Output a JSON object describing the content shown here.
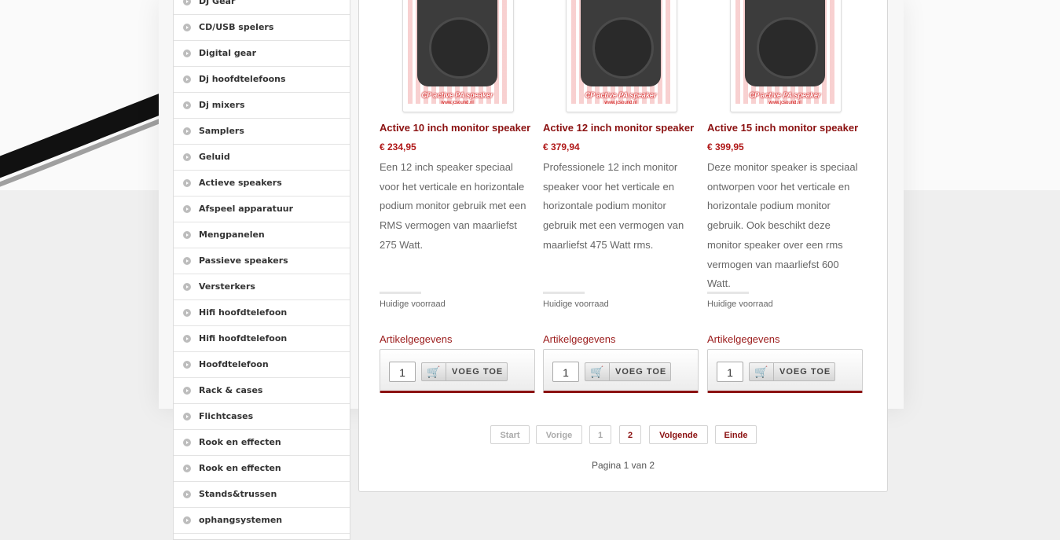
{
  "sidebar": {
    "items": [
      {
        "label": "DJ Gear"
      },
      {
        "label": "CD/USB spelers"
      },
      {
        "label": "Digital gear"
      },
      {
        "label": "Dj hoofdtelefoons"
      },
      {
        "label": "Dj mixers"
      },
      {
        "label": "Samplers"
      },
      {
        "label": "Geluid"
      },
      {
        "label": "Actieve speakers"
      },
      {
        "label": "Afspeel apparatuur"
      },
      {
        "label": "Mengpanelen"
      },
      {
        "label": "Passieve speakers"
      },
      {
        "label": "Versterkers"
      },
      {
        "label": "Hifi hoofdtelefoon"
      },
      {
        "label": "Hifi hoofdtelefoon"
      },
      {
        "label": "Hoofdtelefoon"
      },
      {
        "label": "Rack & cases"
      },
      {
        "label": "Flichtcases"
      },
      {
        "label": "Rook en effecten"
      },
      {
        "label": "Rook en effecten"
      },
      {
        "label": "Stands&trussen"
      },
      {
        "label": "ophangsystemen"
      }
    ]
  },
  "products": [
    {
      "image_label": "CP active PA speaker",
      "image_url_text": "www.jcsound.nl",
      "title": "Active 10 inch monitor speaker",
      "price": "€ 234,95",
      "description": "Een 12 inch speaker speciaal voor het verticale en horizontale podium monitor gebruik met een RMS vermogen van maarliefst 275 Watt.",
      "stock_label": "Huidige voorraad",
      "details_label": "Artikelgegevens",
      "quantity": "1",
      "add_label": "VOEG TOE"
    },
    {
      "image_label": "CP active PA speaker",
      "image_url_text": "www.jcsound.nl",
      "title": "Active 12 inch monitor speaker",
      "price": "€ 379,94",
      "description": "Professionele 12 inch monitor speaker voor het verticale en horizontale podium monitor gebruik met een vermogen van maarliefst 475 Watt rms.",
      "stock_label": "Huidige voorraad",
      "details_label": "Artikelgegevens",
      "quantity": "1",
      "add_label": "VOEG TOE"
    },
    {
      "image_label": "CP active PA speaker",
      "image_url_text": "www.jcsound.nl",
      "title": "Active 15 inch monitor speaker",
      "price": "€ 399,95",
      "description": "Deze monitor speaker is speciaal ontworpen voor het verticale en horizontale podium monitor gebruik. Ook beschikt deze monitor speaker over een rms vermogen van maarliefst 600 Watt.",
      "stock_label": "Huidige voorraad",
      "details_label": "Artikelgegevens",
      "quantity": "1",
      "add_label": "VOEG TOE"
    }
  ],
  "pagination": {
    "start": "Start",
    "prev": "Vorige",
    "page1": "1",
    "page2": "2",
    "next": "Volgende",
    "end": "Einde",
    "info": "Pagina 1 van 2"
  },
  "icons": {
    "cart": "cart-icon",
    "bullet": "chevron-right-icon"
  },
  "colors": {
    "accent": "#8b1111",
    "price": "#b01818"
  }
}
